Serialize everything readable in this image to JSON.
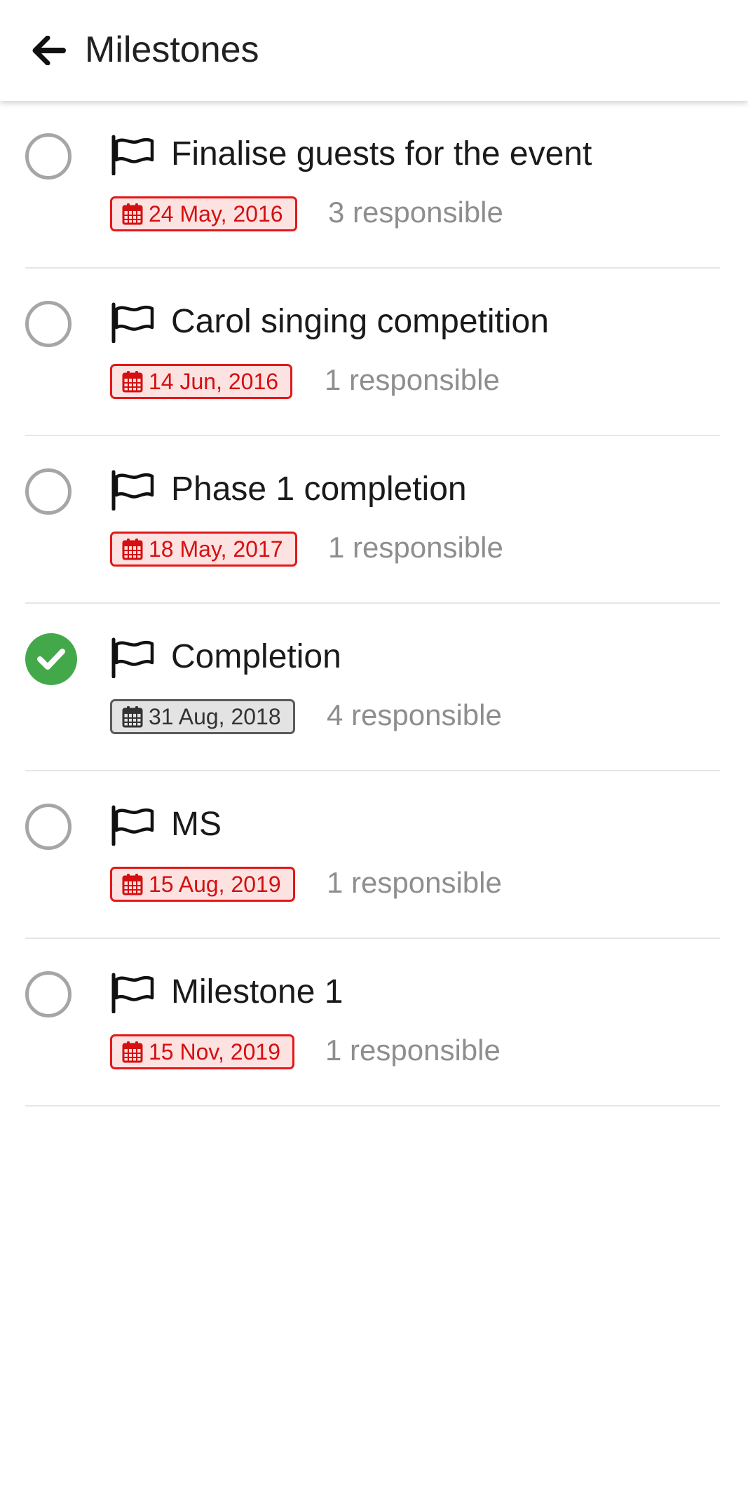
{
  "header": {
    "title": "Milestones",
    "back_icon": "arrow-left-icon"
  },
  "colors": {
    "overdue_text": "#d50f0f",
    "overdue_border": "#e31818",
    "overdue_bg": "#fde2e2",
    "completed": "#43a84a",
    "muted": "#8e8e8e"
  },
  "milestones": [
    {
      "title": "Finalise guests for the event",
      "date": "24 May, 2016",
      "responsible": "3 responsible",
      "completed": false,
      "status": "overdue"
    },
    {
      "title": "Carol singing competition",
      "date": "14 Jun, 2016",
      "responsible": "1 responsible",
      "completed": false,
      "status": "overdue"
    },
    {
      "title": "Phase 1 completion",
      "date": "18 May, 2017",
      "responsible": "1 responsible",
      "completed": false,
      "status": "overdue"
    },
    {
      "title": "Completion",
      "date": "31 Aug, 2018",
      "responsible": "4 responsible",
      "completed": true,
      "status": "done"
    },
    {
      "title": "MS",
      "date": "15 Aug, 2019",
      "responsible": "1 responsible",
      "completed": false,
      "status": "overdue"
    },
    {
      "title": "Milestone 1",
      "date": "15 Nov, 2019",
      "responsible": "1 responsible",
      "completed": false,
      "status": "overdue"
    }
  ]
}
